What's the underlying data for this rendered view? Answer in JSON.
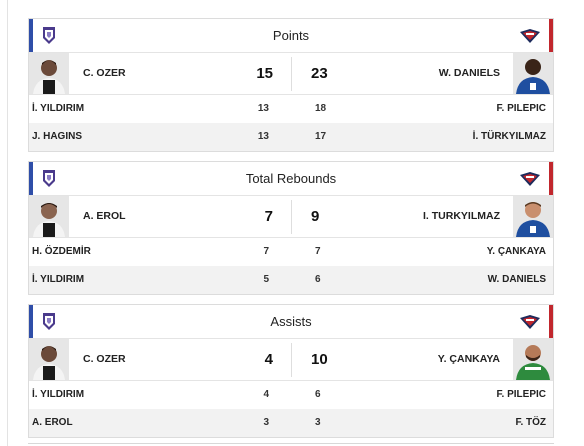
{
  "colors": {
    "home_accent": "#2f4ea8",
    "away_accent": "#c1272d",
    "row_shade": "#f2f2f2"
  },
  "icons": {
    "home_logo": "home-team-logo",
    "away_logo": "away-team-logo"
  },
  "cards": [
    {
      "title": "Points",
      "leader": {
        "home_name": "C. OZER",
        "home_value": "15",
        "away_value": "23",
        "away_name": "W. DANIELS"
      },
      "rows": [
        {
          "home_name": "İ. YILDIRIM",
          "home_value": "13",
          "away_value": "18",
          "away_name": "F. PILEPIC"
        },
        {
          "home_name": "J. HAGINS",
          "home_value": "13",
          "away_value": "17",
          "away_name": "İ. TÜRKYILMAZ"
        }
      ]
    },
    {
      "title": "Total Rebounds",
      "leader": {
        "home_name": "A. EROL",
        "home_value": "7",
        "away_value": "9",
        "away_name": "I. TURKYILMAZ"
      },
      "rows": [
        {
          "home_name": "H. ÖZDEMİR",
          "home_value": "7",
          "away_value": "7",
          "away_name": "Y. ÇANKAYA"
        },
        {
          "home_name": "İ. YILDIRIM",
          "home_value": "5",
          "away_value": "6",
          "away_name": "W. DANIELS"
        }
      ]
    },
    {
      "title": "Assists",
      "leader": {
        "home_name": "C. OZER",
        "home_value": "4",
        "away_value": "10",
        "away_name": "Y. ÇANKAYA"
      },
      "rows": [
        {
          "home_name": "İ. YILDIRIM",
          "home_value": "4",
          "away_value": "6",
          "away_name": "F. PILEPIC"
        },
        {
          "home_name": "A. EROL",
          "home_value": "3",
          "away_value": "3",
          "away_name": "F. TÖZ"
        }
      ]
    }
  ]
}
